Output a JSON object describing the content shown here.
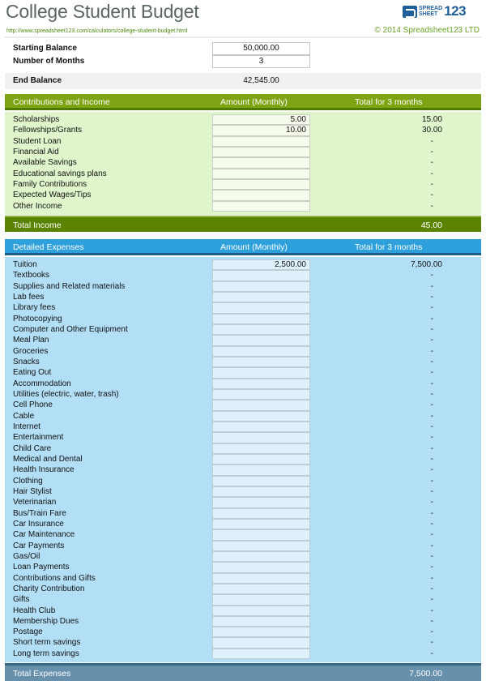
{
  "header": {
    "title": "College Student Budget",
    "url": "http://www.spreadsheet123.com/calculators/college-student-budget.html",
    "copyright": "© 2014 Spreadsheet123 LTD",
    "logo": {
      "line1": "SPREAD",
      "line2": "SHEET",
      "number": "123"
    }
  },
  "inputs": {
    "starting_balance_label": "Starting Balance",
    "starting_balance_value": "50,000.00",
    "months_label": "Number of Months",
    "months_value": "3",
    "end_balance_label": "End Balance",
    "end_balance_value": "42,545.00"
  },
  "income": {
    "header": {
      "col1": "Contributions and Income",
      "col2": "Amount (Monthly)",
      "col3": "Total for 3 months"
    },
    "rows": [
      {
        "label": "Scholarships",
        "amount": "5.00",
        "total": "15.00"
      },
      {
        "label": "Fellowships/Grants",
        "amount": "10.00",
        "total": "30.00"
      },
      {
        "label": "Student Loan",
        "amount": "",
        "total": "-"
      },
      {
        "label": "Financial Aid",
        "amount": "",
        "total": "-"
      },
      {
        "label": "Available Savings",
        "amount": "",
        "total": "-"
      },
      {
        "label": "Educational savings plans",
        "amount": "",
        "total": "-"
      },
      {
        "label": "Family Contributions",
        "amount": "",
        "total": "-"
      },
      {
        "label": "Expected Wages/Tips",
        "amount": "",
        "total": "-"
      },
      {
        "label": "Other Income",
        "amount": "",
        "total": "-"
      }
    ],
    "footer": {
      "label": "Total Income",
      "value": "45.00"
    }
  },
  "expenses": {
    "header": {
      "col1": "Detailed Expenses",
      "col2": "Amount (Monthly)",
      "col3": "Total for 3 months"
    },
    "rows": [
      {
        "label": "Tuition",
        "amount": "2,500.00",
        "total": "7,500.00"
      },
      {
        "label": "Textbooks",
        "amount": "",
        "total": "-"
      },
      {
        "label": "Supplies and Related materials",
        "amount": "",
        "total": "-"
      },
      {
        "label": "Lab fees",
        "amount": "",
        "total": "-"
      },
      {
        "label": "Library fees",
        "amount": "",
        "total": "-"
      },
      {
        "label": "Photocopying",
        "amount": "",
        "total": "-"
      },
      {
        "label": "Computer and Other Equipment",
        "amount": "",
        "total": "-"
      },
      {
        "label": "Meal Plan",
        "amount": "",
        "total": "-"
      },
      {
        "label": "Groceries",
        "amount": "",
        "total": "-"
      },
      {
        "label": "Snacks",
        "amount": "",
        "total": "-"
      },
      {
        "label": "Eating Out",
        "amount": "",
        "total": "-"
      },
      {
        "label": "Accommodation",
        "amount": "",
        "total": "-"
      },
      {
        "label": "Utilities (electric, water, trash)",
        "amount": "",
        "total": "-"
      },
      {
        "label": "Cell Phone",
        "amount": "",
        "total": "-"
      },
      {
        "label": "Cable",
        "amount": "",
        "total": "-"
      },
      {
        "label": "Internet",
        "amount": "",
        "total": "-"
      },
      {
        "label": "Entertainment",
        "amount": "",
        "total": "-"
      },
      {
        "label": "Child Care",
        "amount": "",
        "total": "-"
      },
      {
        "label": "Medical and Dental",
        "amount": "",
        "total": "-"
      },
      {
        "label": "Health Insurance",
        "amount": "",
        "total": "-"
      },
      {
        "label": "Clothing",
        "amount": "",
        "total": "-"
      },
      {
        "label": "Hair Stylist",
        "amount": "",
        "total": "-"
      },
      {
        "label": "Veterinarian",
        "amount": "",
        "total": "-"
      },
      {
        "label": "Bus/Train Fare",
        "amount": "",
        "total": "-"
      },
      {
        "label": "Car Insurance",
        "amount": "",
        "total": "-"
      },
      {
        "label": "Car Maintenance",
        "amount": "",
        "total": "-"
      },
      {
        "label": "Car Payments",
        "amount": "",
        "total": "-"
      },
      {
        "label": "Gas/Oil",
        "amount": "",
        "total": "-"
      },
      {
        "label": "Loan Payments",
        "amount": "",
        "total": "-"
      },
      {
        "label": "Contributions and Gifts",
        "amount": "",
        "total": "-"
      },
      {
        "label": "Charity Contribution",
        "amount": "",
        "total": "-"
      },
      {
        "label": "Gifts",
        "amount": "",
        "total": "-"
      },
      {
        "label": "Health Club",
        "amount": "",
        "total": "-"
      },
      {
        "label": "Membership Dues",
        "amount": "",
        "total": "-"
      },
      {
        "label": "Postage",
        "amount": "",
        "total": "-"
      },
      {
        "label": "Short term savings",
        "amount": "",
        "total": "-"
      },
      {
        "label": "Long term savings",
        "amount": "",
        "total": "-"
      }
    ],
    "footer": {
      "label": "Total Expenses",
      "value": "7,500.00"
    }
  },
  "colors": {
    "income_header": "#7ea414",
    "income_body": "#e0f5cc",
    "income_footer": "#5a8400",
    "expense_header": "#2ea0dc",
    "expense_body": "#b2dff5",
    "expense_footer": "#6690ab",
    "url_text": "#4e8a10",
    "title_text": "#5c6660"
  }
}
